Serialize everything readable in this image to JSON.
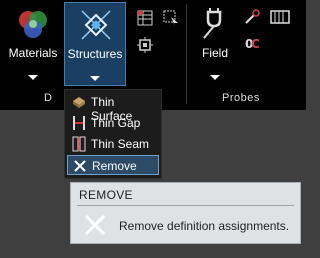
{
  "ribbon": {
    "materials": {
      "label": "Materials",
      "icon": "materials-spheres-icon"
    },
    "structures": {
      "label": "Structures",
      "icon": "structures-icon"
    },
    "field": {
      "label": "Field",
      "icon": "field-icon"
    },
    "groups": {
      "left_partial": "D",
      "probes": "Probes"
    }
  },
  "menu": {
    "items": [
      {
        "label": "Thin Surface",
        "icon": "thin-surface-icon"
      },
      {
        "label": "Thin Gap",
        "icon": "thin-gap-icon"
      },
      {
        "label": "Thin Seam",
        "icon": "thin-seam-icon"
      },
      {
        "label": "Remove",
        "icon": "remove-x-icon",
        "selected": true
      }
    ]
  },
  "tooltip": {
    "title": "Remove",
    "description": "Remove definition assignments.",
    "icon": "remove-x-icon"
  },
  "colors": {
    "ribbon_bg": "#000000",
    "active_button_bg": "#1a3f63",
    "menu_bg": "#1c1c1c",
    "selected_item_bg": "#2d4a66",
    "tooltip_bg": "#dfe2e5",
    "workspace_bg": "#3f3f3f"
  }
}
